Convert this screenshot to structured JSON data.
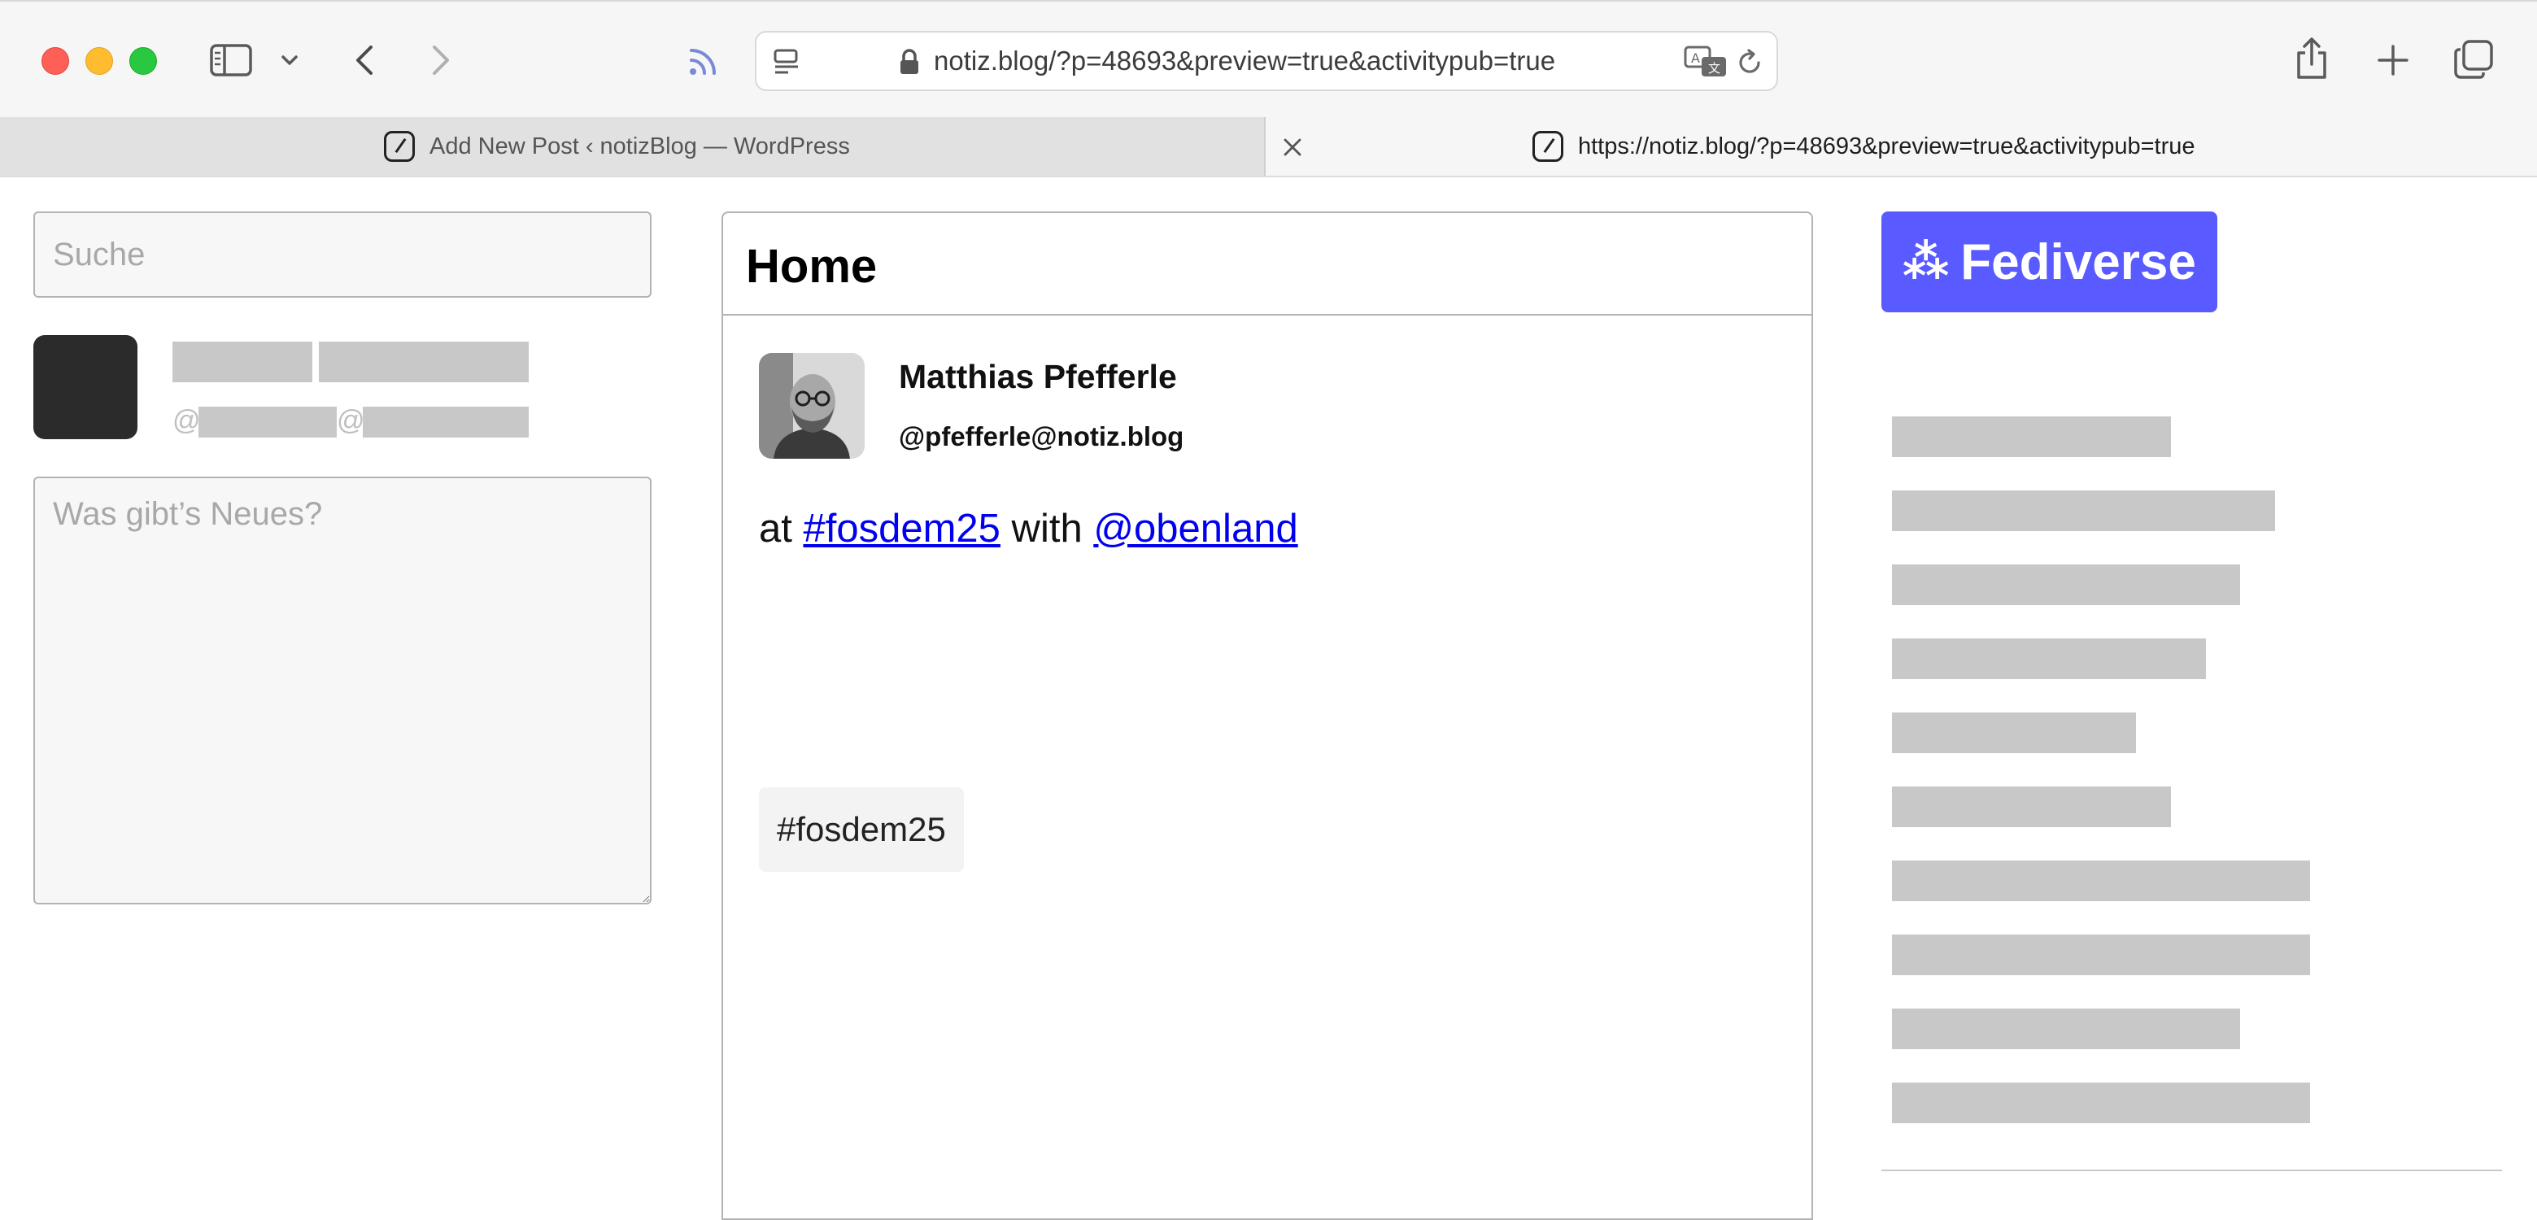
{
  "browser": {
    "url": "notiz.blog/?p=48693&preview=true&activitypub=true",
    "tabs": [
      {
        "label": "Add New Post ‹ notizBlog — WordPress",
        "active": false
      },
      {
        "label": "https://notiz.blog/?p=48693&preview=true&activitypub=true",
        "active": true
      }
    ],
    "icons": [
      "sidebar-icon",
      "chevron-down-icon",
      "back-icon",
      "forward-icon",
      "rss-icon",
      "reader-icon",
      "lock-icon",
      "translate-icon",
      "reload-icon",
      "share-icon",
      "plus-icon",
      "tabs-overview-icon",
      "close-icon"
    ]
  },
  "left": {
    "search_placeholder": "Suche",
    "compose_placeholder": "Was gibt’s Neues?",
    "handle_at_1": "@",
    "handle_at_2": "@"
  },
  "timeline": {
    "title": "Home",
    "post": {
      "author": "Matthias Pfefferle",
      "handle": "@pfefferle@notiz.blog",
      "text_at": "at ",
      "tag_link": "#fosdem25",
      "text_with": " with ",
      "mention_link": "@obenland",
      "hashtag_chip": "#fosdem25"
    }
  },
  "right": {
    "fediverse_glyph": "⁂",
    "fediverse_label": "Fediverse",
    "skeleton_rows": [
      0.336,
      0.462,
      0.42,
      0.378,
      0.294,
      0.336,
      0.504,
      0.504,
      0.42,
      0.504
    ]
  },
  "colors": {
    "fediverse_accent": "#595aff",
    "link": "#0000ee",
    "traffic_red": "#ff5f57",
    "traffic_yellow": "#febc2e",
    "traffic_green": "#28c840"
  }
}
